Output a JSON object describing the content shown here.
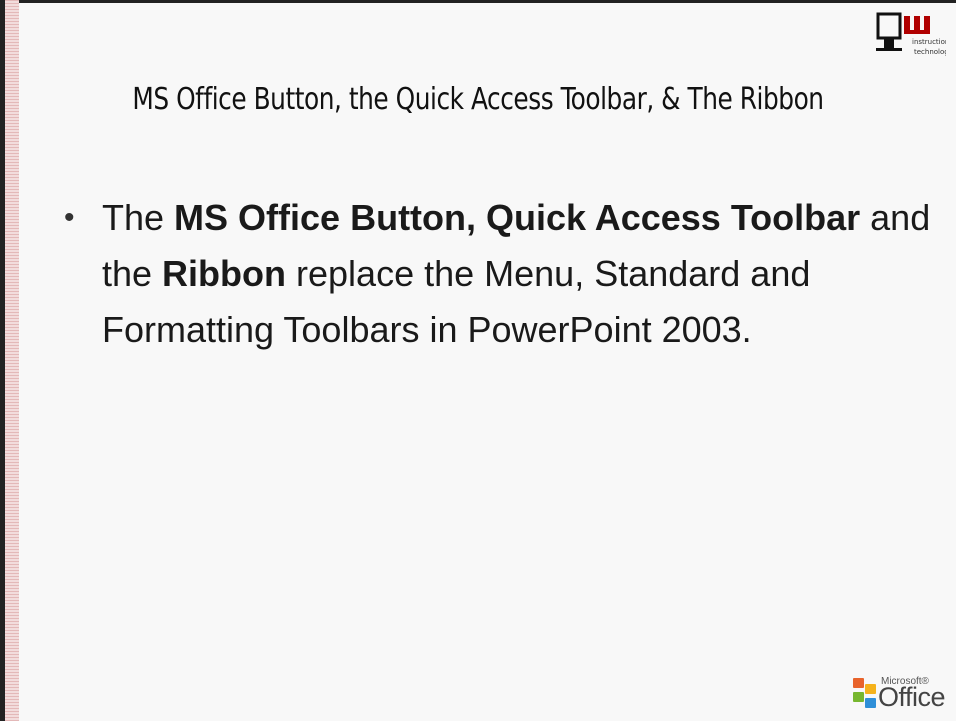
{
  "slide": {
    "title": "MS Office Button, the Quick Access Toolbar, & The Ribbon",
    "bullet": {
      "t1": "The ",
      "b1": "MS Office Button, Quick Access Toolbar",
      "t2": " and the ",
      "b2": "Ribbon",
      "t3": " replace the Menu, Standard and Formatting Toolbars in PowerPoint 2003."
    }
  },
  "logo_iu": {
    "mark": "IU",
    "line1": "instructional",
    "line2": "technology"
  },
  "logo_ms": {
    "small": "Microsoft®",
    "big": "Office",
    "colors": [
      "#e8632b",
      "#f5b21b",
      "#77b72f",
      "#2f8fd8"
    ]
  }
}
